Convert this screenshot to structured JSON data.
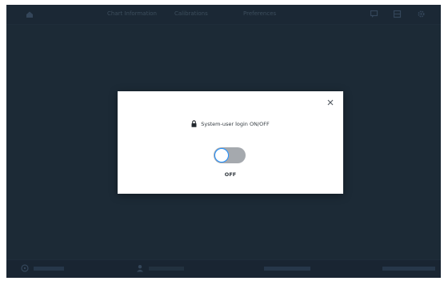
{
  "top_nav": {
    "links": [
      "Chart Information",
      "Calibrations",
      "Preferences"
    ],
    "icons": [
      "home-icon",
      "chat-icon",
      "grid-icon",
      "gear-icon"
    ]
  },
  "modal": {
    "title": "System-user login ON/OFF",
    "toggle": {
      "state": "off",
      "state_label": "OFF"
    },
    "icons": [
      "lock-icon",
      "close-icon"
    ]
  },
  "bottom_bar": {
    "icons": [
      "help-icon",
      "user-icon"
    ]
  },
  "colors": {
    "backdrop": "#1c2a36",
    "modal_bg": "#ffffff",
    "toggle_track_off": "#a5a9ae",
    "toggle_knob_border": "#1f8fff",
    "text_dark": "#333a40"
  }
}
